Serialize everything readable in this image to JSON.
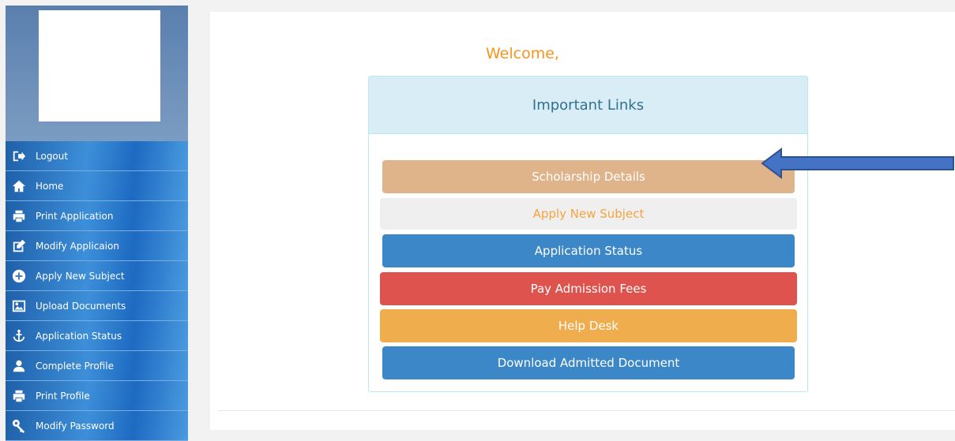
{
  "sidebar": {
    "items": [
      {
        "label": "Logout",
        "icon": "logout-icon"
      },
      {
        "label": "Home",
        "icon": "home-icon"
      },
      {
        "label": "Print Application",
        "icon": "printer-icon"
      },
      {
        "label": "Modify Applicaion",
        "icon": "edit-icon"
      },
      {
        "label": "Apply New Subject",
        "icon": "plus-circle-icon"
      },
      {
        "label": "Upload Documents",
        "icon": "image-icon"
      },
      {
        "label": "Application Status",
        "icon": "anchor-icon"
      },
      {
        "label": "Complete Profile",
        "icon": "user-icon"
      },
      {
        "label": "Print Profile",
        "icon": "printer-icon"
      },
      {
        "label": "Modify Password",
        "icon": "key-icon"
      }
    ]
  },
  "main": {
    "welcome": "Welcome,",
    "panel_title": "Important Links",
    "links": {
      "scholarship": "Scholarship Details",
      "apply_subject": "Apply New Subject",
      "app_status": "Application Status",
      "pay_fees": "Pay Admission Fees",
      "help_desk": "Help Desk",
      "download_doc": "Download Admitted Document"
    }
  },
  "colors": {
    "sidebar_blue": "#2f74c0",
    "welcome_orange": "#f7941d",
    "scholarship": "#e0b48a",
    "primary": "#3c87c7",
    "danger": "#de534e",
    "warning": "#f0ad4e",
    "arrow": "#4472c4"
  }
}
